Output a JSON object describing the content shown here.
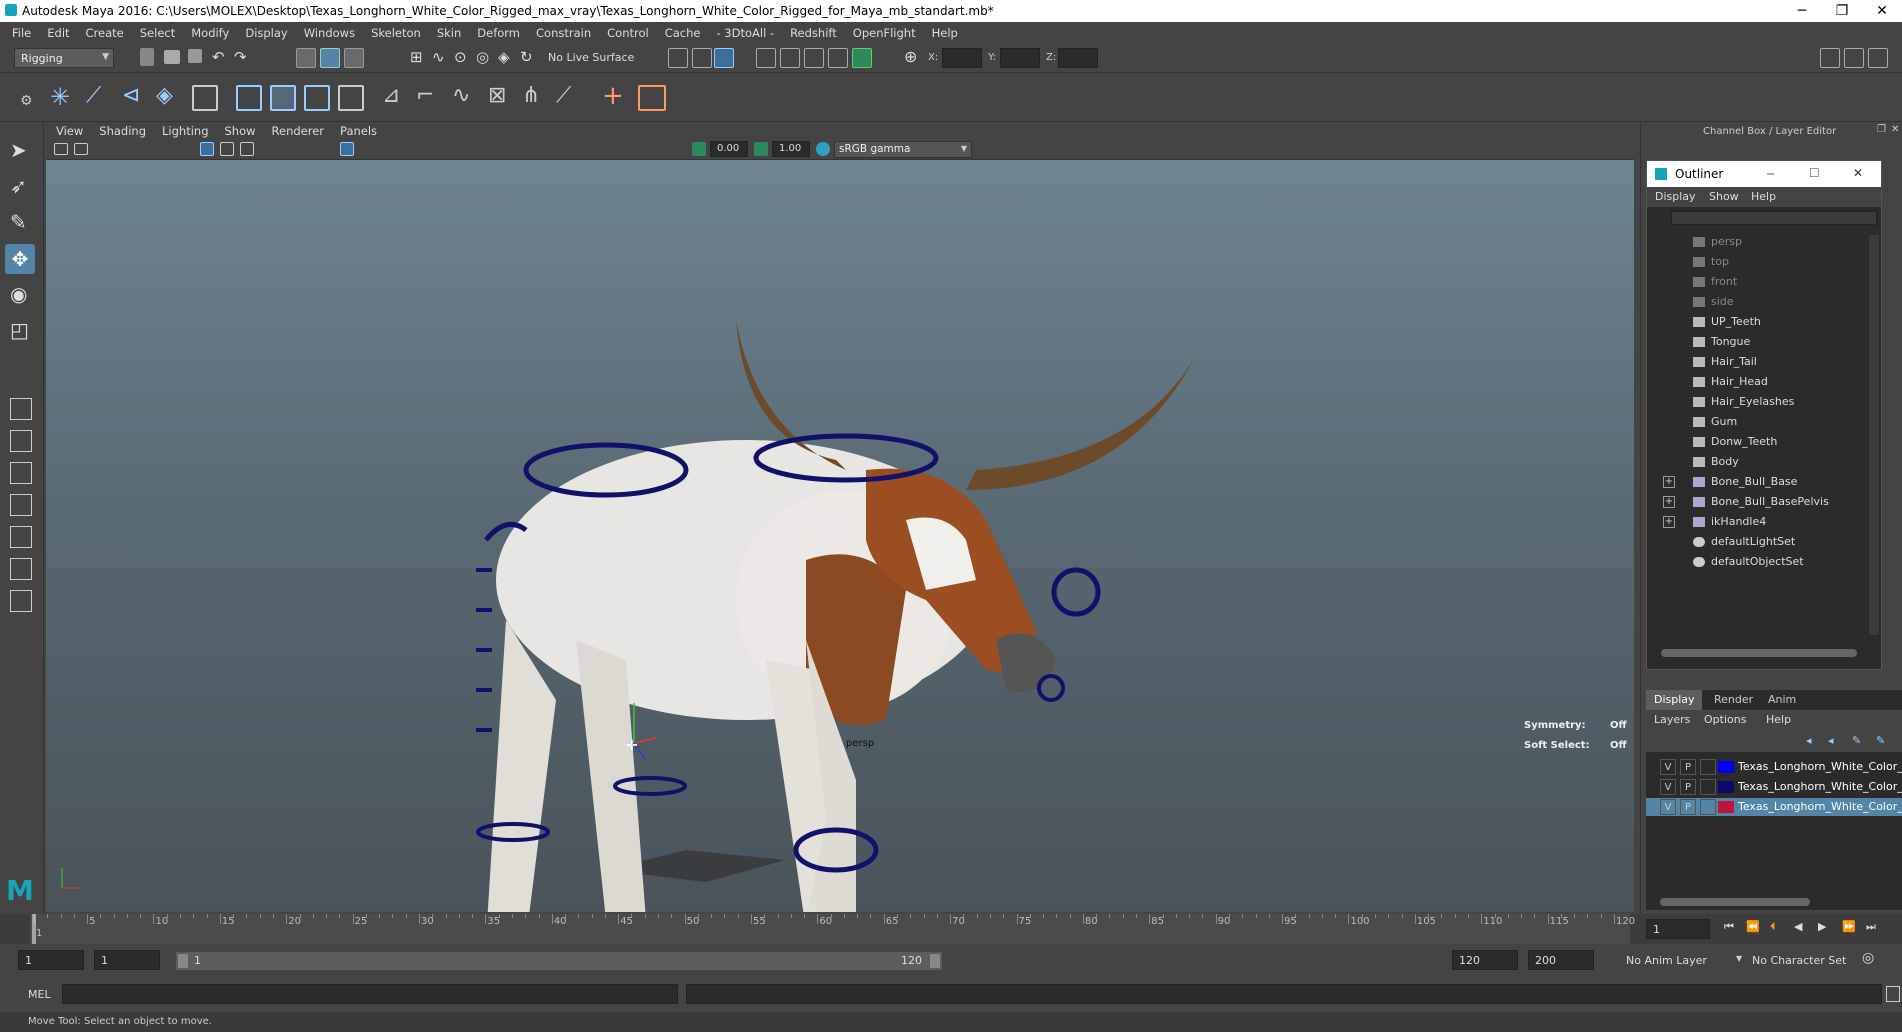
{
  "window": {
    "title": "Autodesk Maya 2016: C:\\Users\\MOLEX\\Desktop\\Texas_Longhorn_White_Color_Rigged_max_vray\\Texas_Longhorn_White_Color_Rigged_for_Maya_mb_standart.mb*",
    "minimize": "─",
    "maximize": "❐",
    "close": "✕"
  },
  "menubar": [
    "File",
    "Edit",
    "Create",
    "Select",
    "Modify",
    "Display",
    "Windows",
    "Skeleton",
    "Skin",
    "Deform",
    "Constrain",
    "Control",
    "Cache",
    "- 3DtoAll -",
    "Redshift",
    "OpenFlight",
    "Help"
  ],
  "statusline": {
    "menuset": "Rigging",
    "live_surface": "No Live Surface",
    "x_label": "X:",
    "y_label": "Y:",
    "z_label": "Z:"
  },
  "viewport": {
    "menus": [
      "View",
      "Shading",
      "Lighting",
      "Show",
      "Renderer",
      "Panels"
    ],
    "exposure": "0.00",
    "gamma": "1.00",
    "colorspace": "sRGB gamma",
    "camera_label": "persp",
    "symmetry_label": "Symmetry:",
    "symmetry_value": "Off",
    "softselect_label": "Soft Select:",
    "softselect_value": "Off"
  },
  "rightpanel": {
    "title": "Channel Box / Layer Editor"
  },
  "outliner": {
    "title": "Outliner",
    "menus": [
      "Display",
      "Show",
      "Help"
    ],
    "items": [
      {
        "label": "persp",
        "kind": "camera",
        "dim": true
      },
      {
        "label": "top",
        "kind": "camera",
        "dim": true
      },
      {
        "label": "front",
        "kind": "camera",
        "dim": true
      },
      {
        "label": "side",
        "kind": "camera",
        "dim": true
      },
      {
        "label": "UP_Teeth",
        "kind": "mesh",
        "dim": false
      },
      {
        "label": "Tongue",
        "kind": "mesh",
        "dim": false
      },
      {
        "label": "Hair_Tail",
        "kind": "mesh",
        "dim": false
      },
      {
        "label": "Hair_Head",
        "kind": "mesh",
        "dim": false
      },
      {
        "label": "Hair_Eyelashes",
        "kind": "mesh",
        "dim": false
      },
      {
        "label": "Gum",
        "kind": "mesh",
        "dim": false
      },
      {
        "label": "Donw_Teeth",
        "kind": "mesh",
        "dim": false
      },
      {
        "label": "Body",
        "kind": "mesh",
        "dim": false
      },
      {
        "label": "Bone_Bull_Base",
        "kind": "joint",
        "dim": false,
        "expand": "+"
      },
      {
        "label": "Bone_Bull_BasePelvis",
        "kind": "joint",
        "dim": false,
        "expand": "+"
      },
      {
        "label": "ikHandle4",
        "kind": "ik",
        "dim": false,
        "expand": "+"
      },
      {
        "label": "defaultLightSet",
        "kind": "set",
        "dim": false
      },
      {
        "label": "defaultObjectSet",
        "kind": "set",
        "dim": false
      }
    ]
  },
  "layer_editor": {
    "tabs": [
      "Display",
      "Render",
      "Anim"
    ],
    "menus": [
      "Layers",
      "Options",
      "Help"
    ],
    "layers": [
      {
        "v": "V",
        "p": "P",
        "name": "Texas_Longhorn_White_Color_",
        "color": "#0000ff",
        "selected": false
      },
      {
        "v": "V",
        "p": "P",
        "name": "Texas_Longhorn_White_Color_",
        "color": "#0a0a6a",
        "selected": false
      },
      {
        "v": "V",
        "p": "P",
        "name": "Texas_Longhorn_White_Color_",
        "color": "#c0143c",
        "selected": true
      }
    ]
  },
  "timeline": {
    "ticks": [
      "1",
      "5",
      "10",
      "15",
      "20",
      "25",
      "30",
      "35",
      "40",
      "45",
      "50",
      "55",
      "60",
      "65",
      "70",
      "75",
      "80",
      "85",
      "90",
      "95",
      "100",
      "105",
      "110",
      "115",
      "120"
    ],
    "current_frame": "1"
  },
  "range": {
    "start": "1",
    "inner_start": "1",
    "slider_start": "1",
    "slider_end": "120",
    "end": "120",
    "outer_end": "200",
    "anim_layer": "No Anim Layer",
    "char_set": "No Character Set"
  },
  "cmdline": {
    "label": "MEL"
  },
  "helpline": {
    "text": "Move Tool: Select an object to move."
  }
}
